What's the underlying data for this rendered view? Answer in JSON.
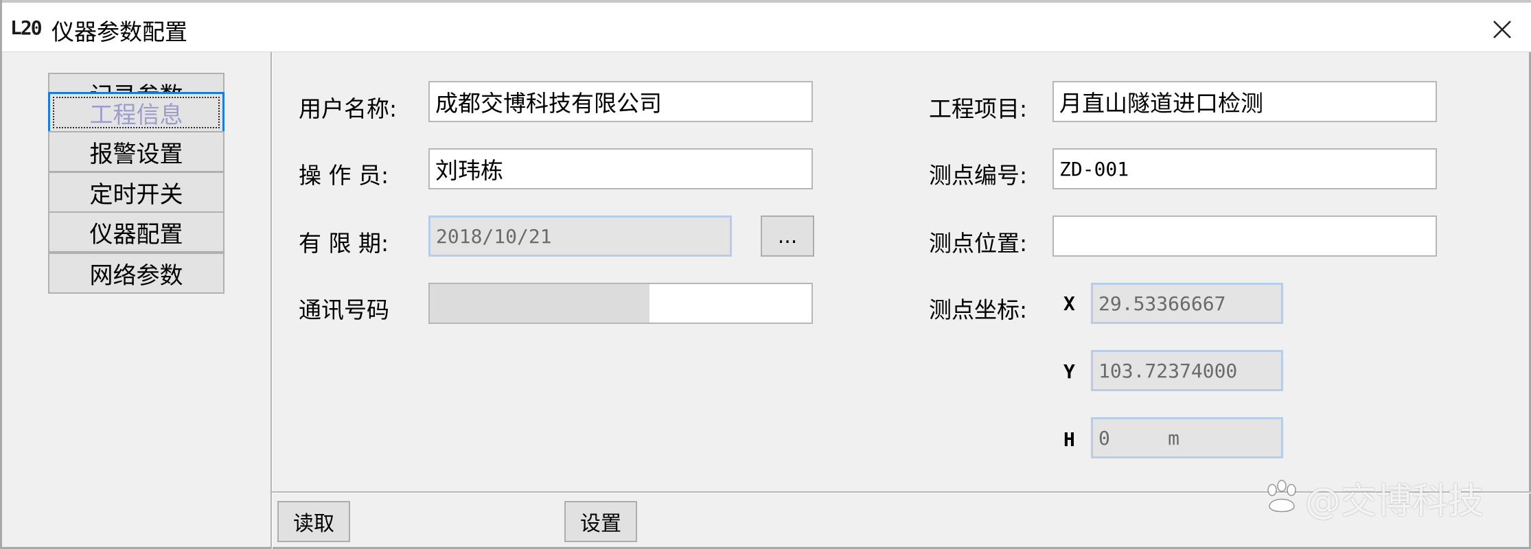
{
  "window": {
    "logo": "L20",
    "title": "仪器参数配置"
  },
  "sidebar": {
    "items": [
      {
        "label": "记录参数"
      },
      {
        "label": "工程信息",
        "active": true
      },
      {
        "label": "报警设置"
      },
      {
        "label": "定时开关"
      },
      {
        "label": "仪器配置"
      },
      {
        "label": "网络参数"
      }
    ]
  },
  "form": {
    "user_name": {
      "label": "用户名称:",
      "value": "成都交博科技有限公司"
    },
    "operator": {
      "label": "操 作 员:",
      "value": "刘玮栋"
    },
    "validity": {
      "label": "有 限 期:",
      "value": "2018/10/21",
      "picker_label": "..."
    },
    "comm_number": {
      "label": "通讯号码",
      "value": ""
    },
    "project": {
      "label": "工程项目:",
      "value": "月直山隧道进口检测"
    },
    "point_id": {
      "label": "测点编号:",
      "value": "ZD-001"
    },
    "point_location": {
      "label": "测点位置:",
      "value": ""
    },
    "coordinates": {
      "label": "测点坐标:",
      "x": {
        "axis": "X",
        "value": "29.53366667"
      },
      "y": {
        "axis": "Y",
        "value": "103.72374000"
      },
      "h": {
        "axis": "H",
        "value": "0     m"
      }
    }
  },
  "footer": {
    "read_label": "读取",
    "set_label": "设置"
  },
  "watermark": {
    "text": "@交博科技",
    "icon": "paw-logo-icon"
  },
  "colors": {
    "active_border": "#1c7ad9",
    "active_text": "#9d9dcc",
    "disabled_border": "#b7cce6"
  }
}
